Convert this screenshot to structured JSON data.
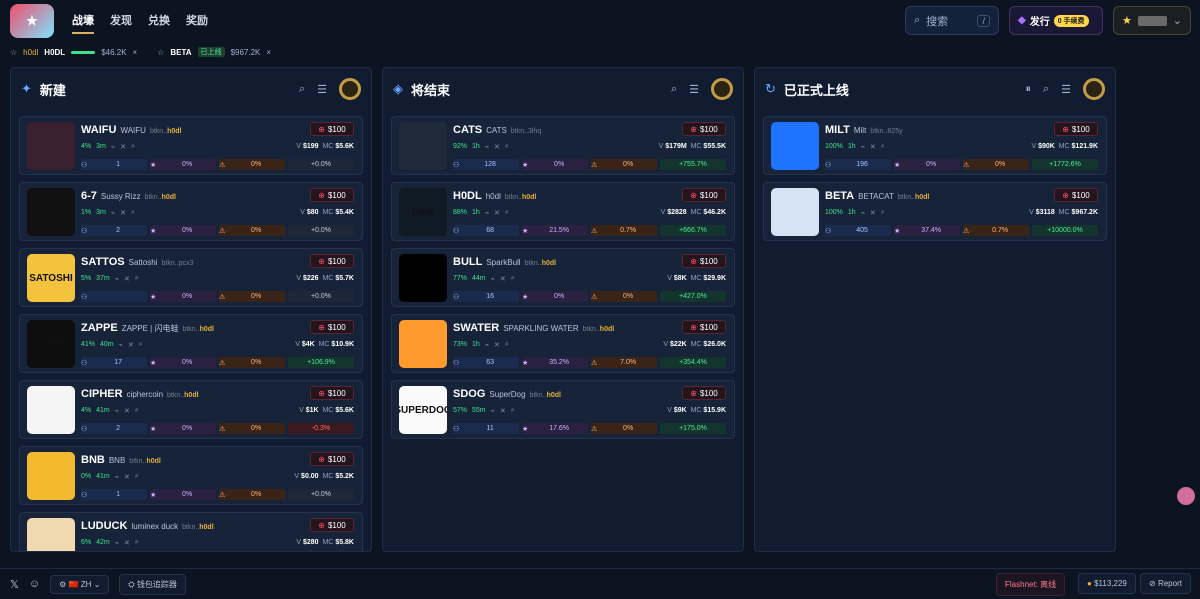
{
  "nav": {
    "items": [
      "战壕",
      "发现",
      "兑换",
      "奖励"
    ]
  },
  "search": {
    "label": "搜索",
    "key": "/"
  },
  "issue": {
    "label": "发行",
    "fee": "0 手续费"
  },
  "pinned": [
    {
      "symbol": "H0DL",
      "tag": "h0dl",
      "value": "$46.2K"
    },
    {
      "symbol": "BETA",
      "status": "已上线",
      "value": "$967.2K"
    }
  ],
  "columns": [
    {
      "title": "新建",
      "cards": [
        {
          "sym": "WAIFU",
          "name": "WAIFU",
          "addr": "btkn..",
          "addr2": "h0dl",
          "pct": "4%",
          "time": "3m",
          "v": "$199",
          "mc": "$5.6K",
          "holders": "1",
          "s2": "0%",
          "s3": "0%",
          "chg": "+0.0%",
          "chgType": "neu",
          "avatarBg": "#3a2030",
          "avatarText": ""
        },
        {
          "sym": "6-7",
          "name": "Sussy Rizz",
          "addr": "btkn..",
          "addr2": "h0dl",
          "pct": "1%",
          "time": "3m",
          "v": "$80",
          "mc": "$5.4K",
          "holders": "2",
          "s2": "0%",
          "s3": "0%",
          "chg": "+0.0%",
          "chgType": "neu",
          "avatarBg": "#111",
          "avatarText": ""
        },
        {
          "sym": "SATTOS",
          "name": "Sattoshi",
          "addr": "btkn..pcx3",
          "addr2": "",
          "pct": "5%",
          "time": "37m",
          "v": "$226",
          "mc": "$5.7K",
          "holders": "",
          "s2": "0%",
          "s3": "0%",
          "chg": "+0.0%",
          "chgType": "neu",
          "avatarBg": "#f3c33d",
          "avatarText": "SATOSHI"
        },
        {
          "sym": "ZAPPE",
          "name": "ZAPPE | 闪电蛙",
          "addr": "btkn..",
          "addr2": "h0dl",
          "pct": "41%",
          "time": "40m",
          "v": "$4K",
          "mc": "$10.9K",
          "holders": "17",
          "s2": "0%",
          "s3": "0%",
          "chg": "+106.9%",
          "chgType": "pos",
          "avatarBg": "#0e0e0e",
          "avatarText": "ZAPPE"
        },
        {
          "sym": "CIPHER",
          "name": "ciphercoin",
          "addr": "btkn..",
          "addr2": "h0dl",
          "pct": "4%",
          "time": "41m",
          "v": "$1K",
          "mc": "$5.6K",
          "holders": "2",
          "s2": "0%",
          "s3": "0%",
          "chg": "-0.3%",
          "chgType": "neg",
          "avatarBg": "#f5f5f5",
          "avatarText": ""
        },
        {
          "sym": "BNB",
          "name": "BNB",
          "addr": "btkn..",
          "addr2": "h0dl",
          "pct": "0%",
          "time": "41m",
          "v": "$0.00",
          "mc": "$5.2K",
          "holders": "1",
          "s2": "0%",
          "s3": "0%",
          "chg": "+0.0%",
          "chgType": "neu",
          "avatarBg": "#f3ba2f",
          "avatarText": ""
        },
        {
          "sym": "LUDUCK",
          "name": "luminex duck",
          "addr": "btkn..",
          "addr2": "h0dl",
          "pct": "6%",
          "time": "42m",
          "v": "$280",
          "mc": "$5.8K",
          "holders": "",
          "s2": "",
          "s3": "",
          "chg": "",
          "chgType": "neu",
          "avatarBg": "#f0d8b0",
          "avatarText": ""
        }
      ]
    },
    {
      "title": "将结束",
      "cards": [
        {
          "sym": "CATS",
          "name": "CATS",
          "addr": "btkn..3lhq",
          "addr2": "",
          "pct": "92%",
          "time": "1h",
          "v": "$179M",
          "mc": "$55.5K",
          "holders": "128",
          "s2": "0%",
          "s3": "0%",
          "chg": "+755.7%",
          "chgType": "pos",
          "avatarBg": "#1f2b3a",
          "avatarText": ""
        },
        {
          "sym": "H0DL",
          "name": "h0dl",
          "addr": "btkn..",
          "addr2": "h0dl",
          "pct": "88%",
          "time": "1h",
          "v": "$2828",
          "mc": "$46.2K",
          "holders": "68",
          "s2": "21.5%",
          "s3": "0.7%",
          "chg": "+666.7%",
          "chgType": "pos",
          "avatarBg": "#0f1a25",
          "avatarText": "h0dl"
        },
        {
          "sym": "BULL",
          "name": "SparkBull",
          "addr": "btkn..",
          "addr2": "h0dl",
          "pct": "77%",
          "time": "44m",
          "v": "$8K",
          "mc": "$29.9K",
          "holders": "16",
          "s2": "0%",
          "s3": "0%",
          "chg": "+427.0%",
          "chgType": "pos",
          "avatarBg": "#000",
          "avatarText": ""
        },
        {
          "sym": "SWATER",
          "name": "SPARKLING WATER",
          "addr": "btkn..",
          "addr2": "h0dl",
          "pct": "73%",
          "time": "1h",
          "v": "$22K",
          "mc": "$26.0K",
          "holders": "63",
          "s2": "35.2%",
          "s3": "7.0%",
          "chg": "+354.4%",
          "chgType": "pos",
          "avatarBg": "#ff9a2e",
          "avatarText": ""
        },
        {
          "sym": "SDOG",
          "name": "SuperDog",
          "addr": "btkn..",
          "addr2": "h0dl",
          "pct": "57%",
          "time": "55m",
          "v": "$9K",
          "mc": "$15.9K",
          "holders": "11",
          "s2": "17.6%",
          "s3": "0%",
          "chg": "+175.0%",
          "chgType": "pos",
          "avatarBg": "#fafafa",
          "avatarText": "SUPERDOG"
        }
      ]
    },
    {
      "title": "已正式上线",
      "cards": [
        {
          "sym": "MILT",
          "name": "Milt",
          "addr": "btkn..825y",
          "addr2": "",
          "pct": "100%",
          "time": "1h",
          "v": "$90K",
          "mc": "$121.9K",
          "holders": "196",
          "s2": "0%",
          "s3": "0%",
          "chg": "+1772.6%",
          "chgType": "pos",
          "avatarBg": "#1e74ff",
          "avatarText": ""
        },
        {
          "sym": "BETA",
          "name": "BETACAT",
          "addr": "btkn..",
          "addr2": "h0dl",
          "pct": "100%",
          "time": "1h",
          "v": "$3118",
          "mc": "$967.2K",
          "holders": "405",
          "s2": "37.4%",
          "s3": "0.7%",
          "chg": "+10000.0%",
          "chgType": "pos",
          "avatarBg": "#d5e3f5",
          "avatarText": ""
        }
      ]
    }
  ],
  "buy_label": "$100",
  "footer": {
    "lang": "ZH",
    "wallet": "钱包追踪器",
    "flashnet": "Flashnet: 离线",
    "btc": "$113,229",
    "report": "Report"
  }
}
